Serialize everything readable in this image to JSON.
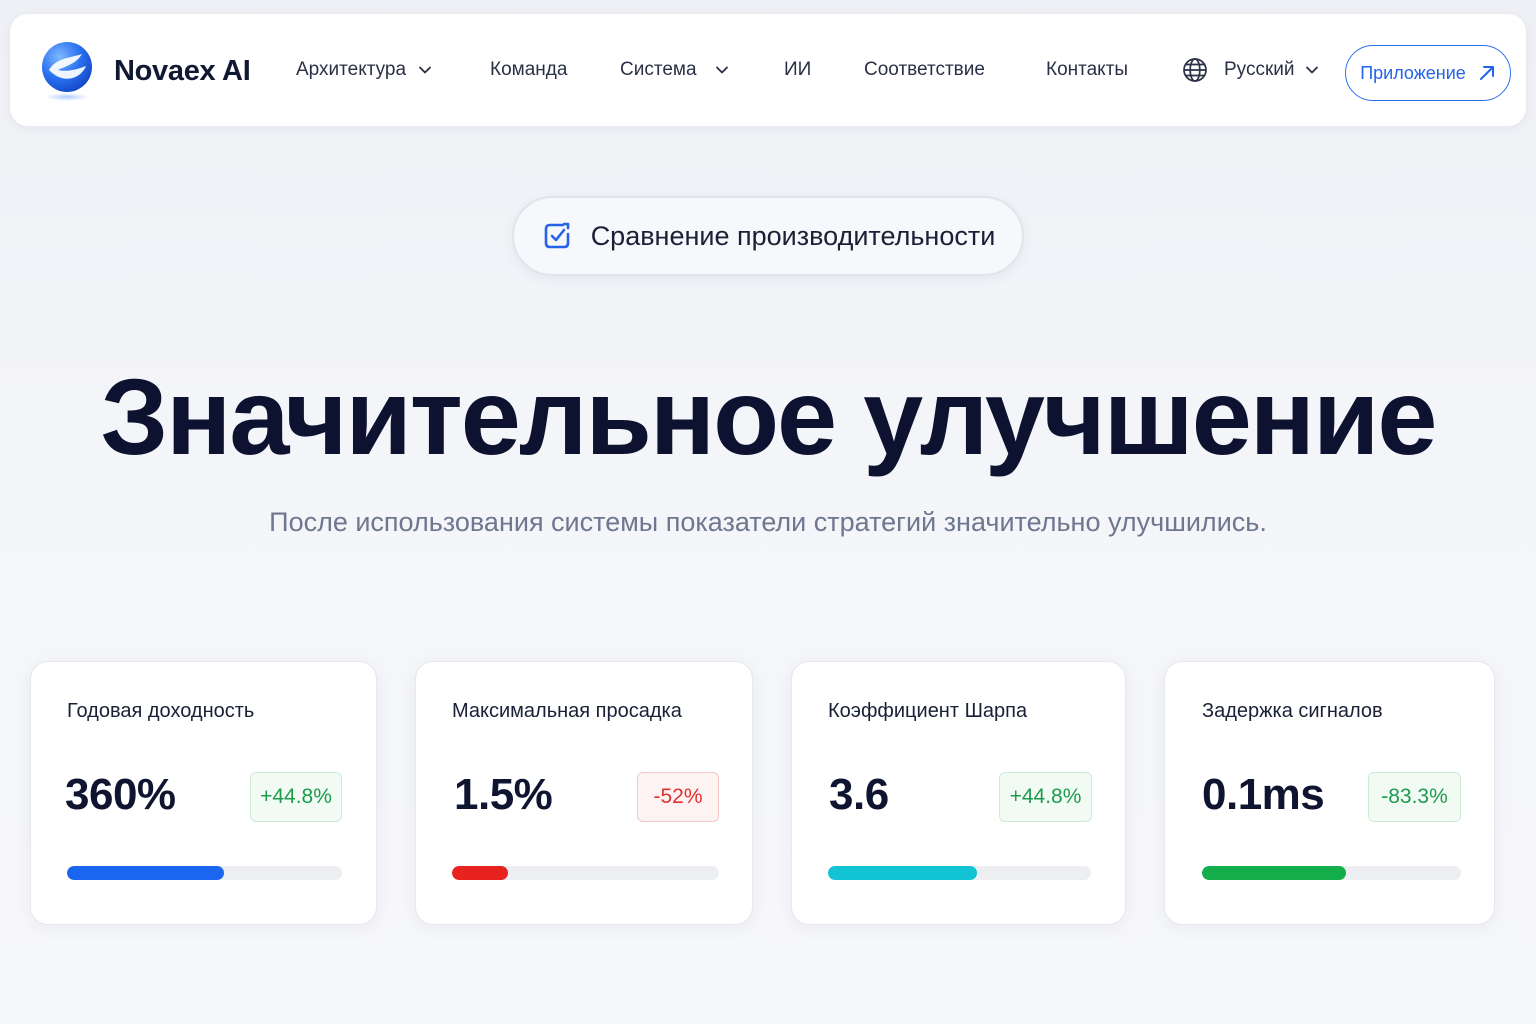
{
  "brand": {
    "name": "Novaex AI"
  },
  "nav": {
    "items": [
      {
        "label": "Архитектура",
        "has_dropdown": true
      },
      {
        "label": "Команда",
        "has_dropdown": false
      },
      {
        "label": "Система",
        "has_dropdown": true
      },
      {
        "label": "ИИ",
        "has_dropdown": false
      },
      {
        "label": "Соответствие",
        "has_dropdown": false
      },
      {
        "label": "Контакты",
        "has_dropdown": false
      }
    ],
    "language": {
      "label": "Русский",
      "icon": "globe-icon"
    },
    "app_button": {
      "label": "Приложение",
      "icon": "arrow-up-right-icon"
    }
  },
  "badge": {
    "label": "Сравнение производительности",
    "icon": "check-square-icon"
  },
  "hero": {
    "title": "Значительное улучшение",
    "subtitle": "После использования системы показатели стратегий значительно улучшились."
  },
  "metrics": [
    {
      "title": "Годовая доходность",
      "value": "360%",
      "delta": "+44.8%",
      "trend": "positive",
      "progress": 0.57,
      "color": "#1a66f0"
    },
    {
      "title": "Максимальная просадка",
      "value": "1.5%",
      "delta": "-52%",
      "trend": "negative",
      "progress": 0.21,
      "color": "#e8231f"
    },
    {
      "title": "Коэффициент Шарпа",
      "value": "3.6",
      "delta": "+44.8%",
      "trend": "positive",
      "progress": 0.565,
      "color": "#12c3d4"
    },
    {
      "title": "Задержка сигналов",
      "value": "0.1ms",
      "delta": "-83.3%",
      "trend": "positive",
      "progress": 0.555,
      "color": "#13ad4a"
    }
  ],
  "colors": {
    "accent": "#2563eb",
    "heading": "#0c1230",
    "muted": "#6f7690"
  }
}
